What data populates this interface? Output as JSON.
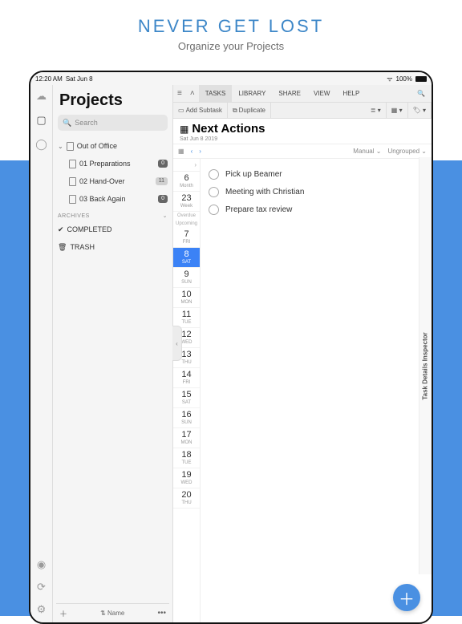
{
  "promo": {
    "title": "NEVER GET LOST",
    "sub": "Organize your Projects"
  },
  "status": {
    "time": "12:20 AM",
    "date": "Sat Jun 8",
    "battery": "100%"
  },
  "sidebar": {
    "title": "Projects",
    "search_placeholder": "Search",
    "root": "Out of Office",
    "items": [
      {
        "label": "01 Preparations",
        "badge": "0"
      },
      {
        "label": "02 Hand-Over",
        "badge": "11"
      },
      {
        "label": "03 Back Again",
        "badge": "0"
      }
    ],
    "archives": "ARCHIVES",
    "completed": "COMPLETED",
    "trash": "TRASH",
    "sort_label": "Name"
  },
  "menubar": {
    "items": [
      "TASKS",
      "LIBRARY",
      "SHARE",
      "VIEW",
      "HELP"
    ]
  },
  "toolbar": {
    "add_subtask": "Add Subtask",
    "duplicate": "Duplicate"
  },
  "header": {
    "title": "Next Actions",
    "date": "Sat Jun 8 2019",
    "sort": "Manual",
    "group": "Ungrouped"
  },
  "datecol": {
    "month": {
      "n": "6",
      "d": "Month"
    },
    "week": {
      "n": "23",
      "d": "Week"
    },
    "overdue": "Overdue",
    "upcoming": "Upcoming",
    "days": [
      {
        "n": "7",
        "d": "FRI"
      },
      {
        "n": "8",
        "d": "SAT",
        "cur": true
      },
      {
        "n": "9",
        "d": "SUN"
      },
      {
        "n": "10",
        "d": "MON"
      },
      {
        "n": "11",
        "d": "TUE"
      },
      {
        "n": "12",
        "d": "WED"
      },
      {
        "n": "13",
        "d": "THU"
      },
      {
        "n": "14",
        "d": "FRI"
      },
      {
        "n": "15",
        "d": "SAT"
      },
      {
        "n": "16",
        "d": "SUN"
      },
      {
        "n": "17",
        "d": "MON"
      },
      {
        "n": "18",
        "d": "TUE"
      },
      {
        "n": "19",
        "d": "WED"
      },
      {
        "n": "20",
        "d": "THU"
      }
    ]
  },
  "tasks": [
    {
      "label": "Pick up Beamer"
    },
    {
      "label": "Meeting with Christian"
    },
    {
      "label": "Prepare tax review"
    }
  ],
  "inspector": "Task Details Inspector"
}
